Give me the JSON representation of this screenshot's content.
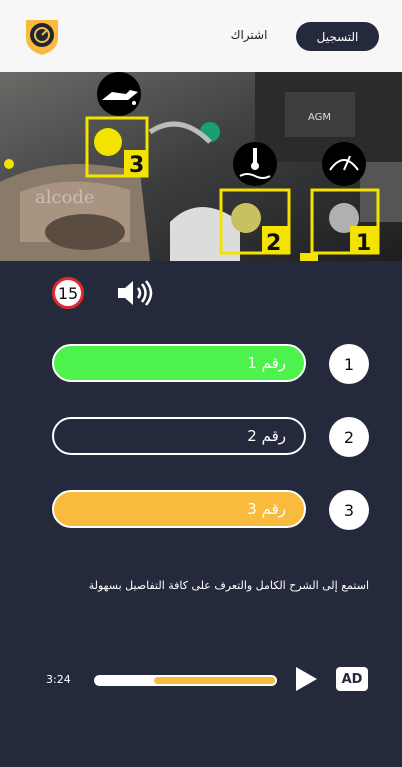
{
  "header": {
    "register_label": "التسجيل",
    "subscribe_label": "اشتراك"
  },
  "hero": {
    "watermark": "alcode",
    "markers": [
      "1",
      "2",
      "3"
    ]
  },
  "quiz": {
    "timer": "15",
    "options": [
      {
        "number": "1",
        "label": "رقم 1",
        "state": "correct",
        "color": "#4ef24c"
      },
      {
        "number": "2",
        "label": "رقم 2",
        "state": "default",
        "color": "#242a3c"
      },
      {
        "number": "3",
        "label": "رقم 3",
        "state": "selected",
        "color": "#f8bb3d"
      }
    ]
  },
  "description": "استمع إلى الشرح الكامل والتعرف على كافة التفاصيل بسهولة",
  "player": {
    "duration": "3:24",
    "ad_label": "AD",
    "progress": 0.66
  },
  "colors": {
    "background": "#242a3c",
    "accent_yellow": "#f8bb3d",
    "correct_green": "#4ef24c",
    "timer_red": "#e3282f"
  }
}
